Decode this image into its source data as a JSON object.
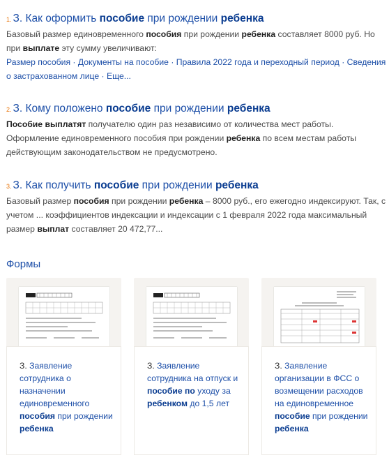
{
  "results": [
    {
      "number": "1.",
      "title_parts": [
        {
          "t": "З. Как оформить ",
          "b": false
        },
        {
          "t": "пособие",
          "b": true
        },
        {
          "t": " при рождении ",
          "b": false
        },
        {
          "t": "ребенка",
          "b": true
        }
      ],
      "snippet_parts": [
        {
          "t": "Базовый размер единовременного ",
          "b": false
        },
        {
          "t": "пособия",
          "b": true
        },
        {
          "t": " при рождении ",
          "b": false
        },
        {
          "t": "ребенка",
          "b": true
        },
        {
          "t": " составляет 8000 руб. Но при ",
          "b": false
        },
        {
          "t": "выплате",
          "b": true
        },
        {
          "t": " эту сумму увеличивают:",
          "b": false
        }
      ],
      "links": "Размер пособия · Документы на пособие · Правила 2022 года и переходный период · Сведения о застрахованном лице · Еще..."
    },
    {
      "number": "2.",
      "title_parts": [
        {
          "t": "З. Кому положено ",
          "b": false
        },
        {
          "t": "пособие",
          "b": true
        },
        {
          "t": " при рождении ",
          "b": false
        },
        {
          "t": "ребенка",
          "b": true
        }
      ],
      "snippet_parts": [
        {
          "t": "Пособие выплатят",
          "b": true
        },
        {
          "t": " получателю один раз независимо от количества мест работы. Оформление единовременного пособия при рождении ",
          "b": false
        },
        {
          "t": "ребенка",
          "b": true
        },
        {
          "t": " по всем местам работы действующим законодательством не предусмотрено.",
          "b": false
        }
      ]
    },
    {
      "number": "3.",
      "title_parts": [
        {
          "t": "З. Как получить ",
          "b": false
        },
        {
          "t": "пособие",
          "b": true
        },
        {
          "t": " при рождении ",
          "b": false
        },
        {
          "t": "ребенка",
          "b": true
        }
      ],
      "snippet_parts": [
        {
          "t": "Базовый размер ",
          "b": false
        },
        {
          "t": "пособия",
          "b": true
        },
        {
          "t": " при рождении ",
          "b": false
        },
        {
          "t": "ребенка",
          "b": true
        },
        {
          "t": " – 8000 руб., его ежегодно индексируют. Так, с учетом ... коэффициентов индексации и индексации с 1 февраля 2022 года максимальный размер ",
          "b": false
        },
        {
          "t": "выплат",
          "b": true
        },
        {
          "t": " составляет 20 472,77...",
          "b": false
        }
      ]
    }
  ],
  "forms_section": {
    "title": "Формы",
    "cards": [
      {
        "prefix": "З. ",
        "parts": [
          {
            "t": "Заявление сотрудника о назначении единовременного ",
            "b": false
          },
          {
            "t": "пособия",
            "b": true
          },
          {
            "t": " при рождении ",
            "b": false
          },
          {
            "t": "ребенка",
            "b": true
          }
        ]
      },
      {
        "prefix": "З. ",
        "parts": [
          {
            "t": "Заявление сотрудника на отпуск и ",
            "b": false
          },
          {
            "t": "пособие по",
            "b": true
          },
          {
            "t": " уходу за ",
            "b": false
          },
          {
            "t": "ребенком",
            "b": true
          },
          {
            "t": " до 1,5 лет",
            "b": false
          }
        ]
      },
      {
        "prefix": "З. ",
        "parts": [
          {
            "t": "Заявление организации в ФСС о возмещении расходов на единовременное ",
            "b": false
          },
          {
            "t": "пособие",
            "b": true
          },
          {
            "t": " при рождении ",
            "b": false
          },
          {
            "t": "ребенка",
            "b": true
          }
        ]
      }
    ]
  },
  "colors": {
    "link": "#1d4fa8",
    "number": "#e8760e",
    "card_bg": "#f5f3f0"
  }
}
